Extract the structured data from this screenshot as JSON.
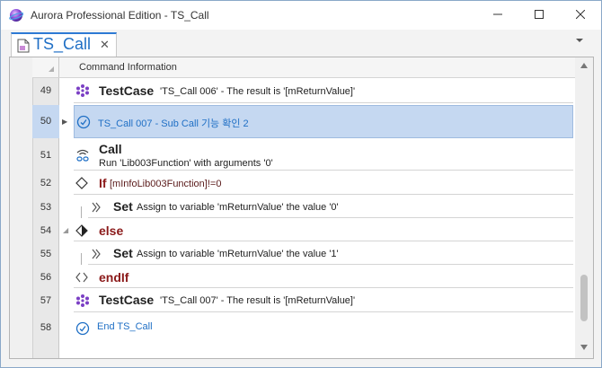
{
  "window": {
    "title": "Aurora Professional Edition - TS_Call"
  },
  "tab": {
    "label": "TS_Call",
    "close": "✕"
  },
  "grid": {
    "header": "Command Information",
    "rows": [
      {
        "num": "49",
        "icon": "testcase-icon",
        "keyword": "TestCase",
        "text": "'TS_Call 006' - The result is '[mReturnValue]'"
      },
      {
        "num": "50",
        "icon": "comment-icon",
        "keyword": "",
        "text": "TS_Call 007 - Sub Call 기능 확인 2",
        "selected": true
      },
      {
        "num": "51",
        "icon": "call-icon",
        "keyword": "Call",
        "text": "Run 'Lib003Function' with arguments '0'"
      },
      {
        "num": "52",
        "icon": "if-icon",
        "keyword": "If",
        "text": "[mInfoLib003Function]!=0"
      },
      {
        "num": "53",
        "icon": "set-icon",
        "keyword": "Set",
        "text": "Assign to variable 'mReturnValue' the value '0'"
      },
      {
        "num": "54",
        "icon": "else-icon",
        "keyword": "else",
        "text": ""
      },
      {
        "num": "55",
        "icon": "set-icon",
        "keyword": "Set",
        "text": "Assign to variable 'mReturnValue' the value '1'"
      },
      {
        "num": "56",
        "icon": "endif-icon",
        "keyword": "endIf",
        "text": ""
      },
      {
        "num": "57",
        "icon": "testcase-icon",
        "keyword": "TestCase",
        "text": "'TS_Call 007' - The result is '[mReturnValue]'"
      },
      {
        "num": "58",
        "icon": "comment-icon",
        "keyword": "",
        "text": "End TS_Call"
      }
    ]
  },
  "colors": {
    "accent": "#1f6fc5",
    "selection": "#c5d8f1",
    "keyword_red": "#8b1a1a",
    "testcase_purple": "#7b3fc4"
  }
}
